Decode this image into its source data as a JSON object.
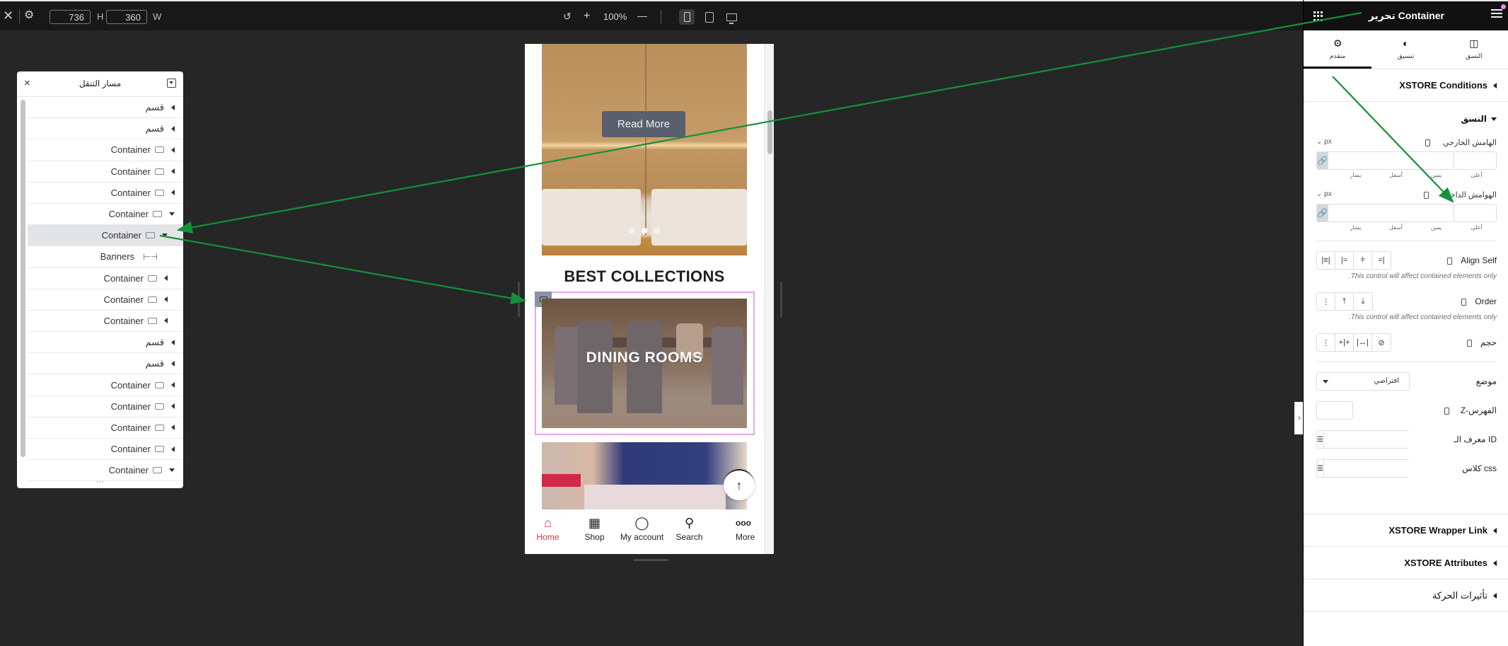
{
  "topbar": {
    "close_icon": "close-icon",
    "settings_icon": "gear-icon",
    "height_value": "736",
    "height_label": "H",
    "width_value": "360",
    "width_label": "W",
    "undo_icon": "undo-icon",
    "zoom_in": "+",
    "zoom_level": "100%",
    "zoom_out": "—",
    "devices": [
      {
        "name": "mobile",
        "active": true
      },
      {
        "name": "tablet",
        "active": false
      },
      {
        "name": "desktop",
        "active": false
      }
    ]
  },
  "navigator": {
    "title": "مسار التنقل",
    "close": "×",
    "footer": "···",
    "items": [
      {
        "label": "قسم",
        "type": "section",
        "expanded": false
      },
      {
        "label": "قسم",
        "type": "section",
        "expanded": false
      },
      {
        "label": "Container",
        "type": "container",
        "expanded": false
      },
      {
        "label": "Container",
        "type": "container",
        "expanded": false
      },
      {
        "label": "Container",
        "type": "container",
        "expanded": false
      },
      {
        "label": "Container",
        "type": "container",
        "expanded": true
      },
      {
        "label": "Container",
        "type": "container",
        "expanded": true,
        "selected": true
      },
      {
        "label": "Banners",
        "type": "widget"
      },
      {
        "label": "Container",
        "type": "container",
        "expanded": false
      },
      {
        "label": "Container",
        "type": "container",
        "expanded": false
      },
      {
        "label": "Container",
        "type": "container",
        "expanded": false
      },
      {
        "label": "قسم",
        "type": "section",
        "expanded": false
      },
      {
        "label": "قسم",
        "type": "section",
        "expanded": false
      },
      {
        "label": "Container",
        "type": "container",
        "expanded": false
      },
      {
        "label": "Container",
        "type": "container",
        "expanded": false
      },
      {
        "label": "Container",
        "type": "container",
        "expanded": false
      },
      {
        "label": "Container",
        "type": "container",
        "expanded": false
      },
      {
        "label": "Container",
        "type": "container",
        "expanded": true
      }
    ]
  },
  "preview": {
    "hero_button": "Read More",
    "section_title": "BEST COLLECTIONS",
    "banner_label": "DINING ROOMS",
    "scroll_top_icon": "↑",
    "bottom_nav": [
      {
        "label": "Home",
        "icon": "home-icon",
        "glyph": "⌂",
        "active": true
      },
      {
        "label": "Shop",
        "icon": "shop-icon",
        "glyph": "▦",
        "active": false
      },
      {
        "label": "My account",
        "icon": "user-icon",
        "glyph": "◯",
        "active": false
      },
      {
        "label": "Search",
        "icon": "search-icon",
        "glyph": "⚲",
        "active": false
      },
      {
        "label": "More",
        "icon": "more-icon",
        "glyph": "ooo",
        "active": false
      }
    ],
    "accent_color": "#e0323f",
    "selection_color": "#e8a6f0"
  },
  "panel": {
    "title": "تحرير Container",
    "tabs": [
      {
        "label": "متقدم",
        "icon": "gear-icon",
        "glyph": "⚙",
        "active": true
      },
      {
        "label": "تنسيق",
        "icon": "contrast-icon",
        "glyph": "◐",
        "active": false
      },
      {
        "label": "النسق",
        "icon": "columns-icon",
        "glyph": "◫",
        "active": false
      }
    ],
    "sections": {
      "xstore_conditions": "XSTORE Conditions",
      "layout": "النسق",
      "xstore_wrapper_link": "XSTORE Wrapper Link",
      "xstore_attributes": "XSTORE Attributes",
      "motion_effects": "تأثيرات الحركة"
    },
    "margin": {
      "label": "الهامش الخارجي",
      "unit": "px",
      "sides": [
        "يسار",
        "أسفل",
        "يمين",
        "أعلى"
      ],
      "values": [
        "",
        "",
        "",
        ""
      ]
    },
    "padding": {
      "label": "الهوامش الداخلية",
      "unit": "px",
      "sides": [
        "يسار",
        "أسفل",
        "يمين",
        "أعلى"
      ],
      "values": [
        "",
        "",
        "",
        ""
      ]
    },
    "align_self": {
      "label": "Align Self",
      "buttons": [
        "|≡|",
        "|=",
        "⫩",
        "=|"
      ],
      "hint": ".This control will affect contained elements only"
    },
    "order": {
      "label": "Order",
      "buttons": [
        "⋮",
        "⤒",
        "⤓"
      ],
      "hint": ".This control will affect contained elements only"
    },
    "size": {
      "label": "حجم",
      "buttons": [
        "⋮",
        "+|+",
        "|↔|",
        "⊘"
      ]
    },
    "position": {
      "label": "موضع",
      "value": "افتراضي"
    },
    "z_index": {
      "label": "Z-الفهرس",
      "value": ""
    },
    "css_id": {
      "label": "معرف الـ ID",
      "value": ""
    },
    "css_classes": {
      "label": "كلاس css",
      "value": ""
    },
    "collapse_toggle": "›"
  }
}
